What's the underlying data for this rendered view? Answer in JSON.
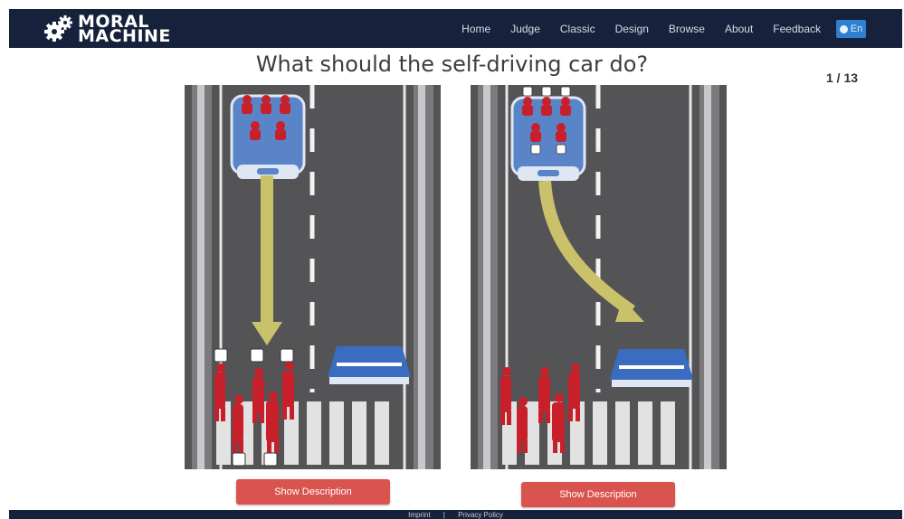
{
  "brand": {
    "line1": "MORAL",
    "line2": "MACHINE"
  },
  "nav": {
    "items": [
      "Home",
      "Judge",
      "Classic",
      "Design",
      "Browse",
      "About",
      "Feedback"
    ],
    "language": "En"
  },
  "question": "What should the self-driving car do?",
  "progress": {
    "label": "1 / 13",
    "current": 1,
    "total": 13
  },
  "scenarios": [
    {
      "button_label": "Show Description"
    },
    {
      "button_label": "Show Description"
    }
  ],
  "footer": {
    "links": [
      "Imprint",
      "|",
      "Privacy Policy"
    ]
  },
  "colors": {
    "nav_bg": "#16213b",
    "road": "#545457",
    "figure_red": "#c8202a",
    "car_blue": "#5a84c8",
    "arrow_yellow": "#c9c26a",
    "button_red": "#d9534f"
  }
}
